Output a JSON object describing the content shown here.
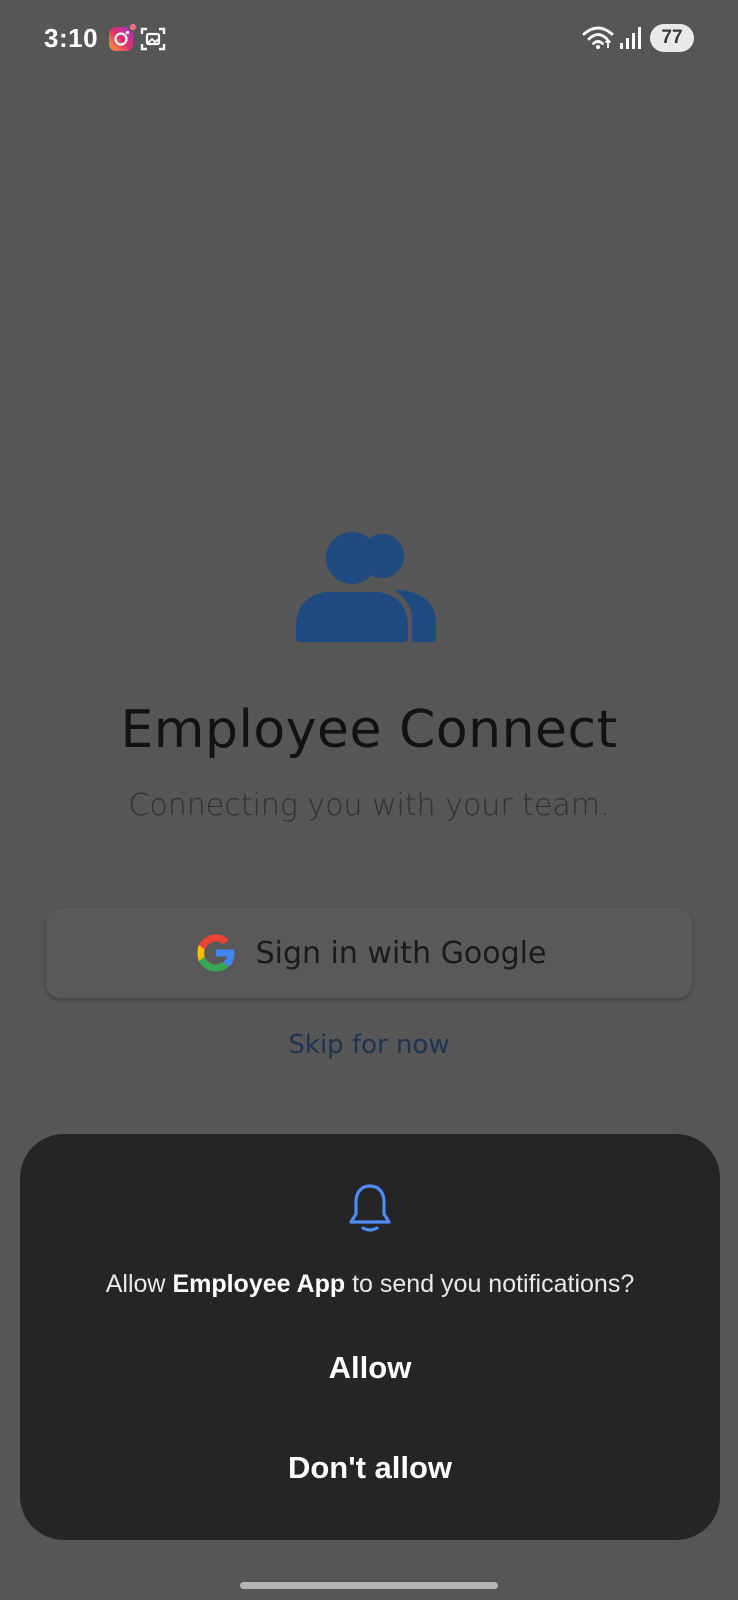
{
  "status_bar": {
    "time": "3:10",
    "battery_level": "77",
    "icons": [
      "instagram-icon",
      "screenshot-icon",
      "wifi-icon",
      "signal-icon",
      "battery-icon"
    ]
  },
  "app": {
    "title": "Employee Connect",
    "tagline": "Connecting you with your team.",
    "icon": "team-icon",
    "brand_color": "#1f4a7f"
  },
  "signin": {
    "google_label": "Sign in with Google",
    "skip_label": "Skip for now"
  },
  "permission_dialog": {
    "message_prefix": "Allow ",
    "app_name": "Employee App",
    "message_suffix": " to send you notifications?",
    "allow_label": "Allow",
    "deny_label": "Don't allow",
    "icon": "bell-icon",
    "accent_color": "#4d8cf5"
  }
}
